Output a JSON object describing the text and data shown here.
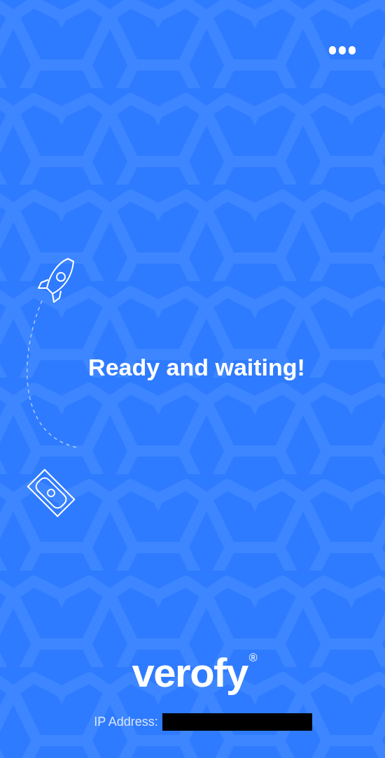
{
  "message": "Ready and waiting!",
  "brand": {
    "name": "verofy",
    "mark": "®"
  },
  "ip_address": {
    "label": "IP Address:"
  }
}
